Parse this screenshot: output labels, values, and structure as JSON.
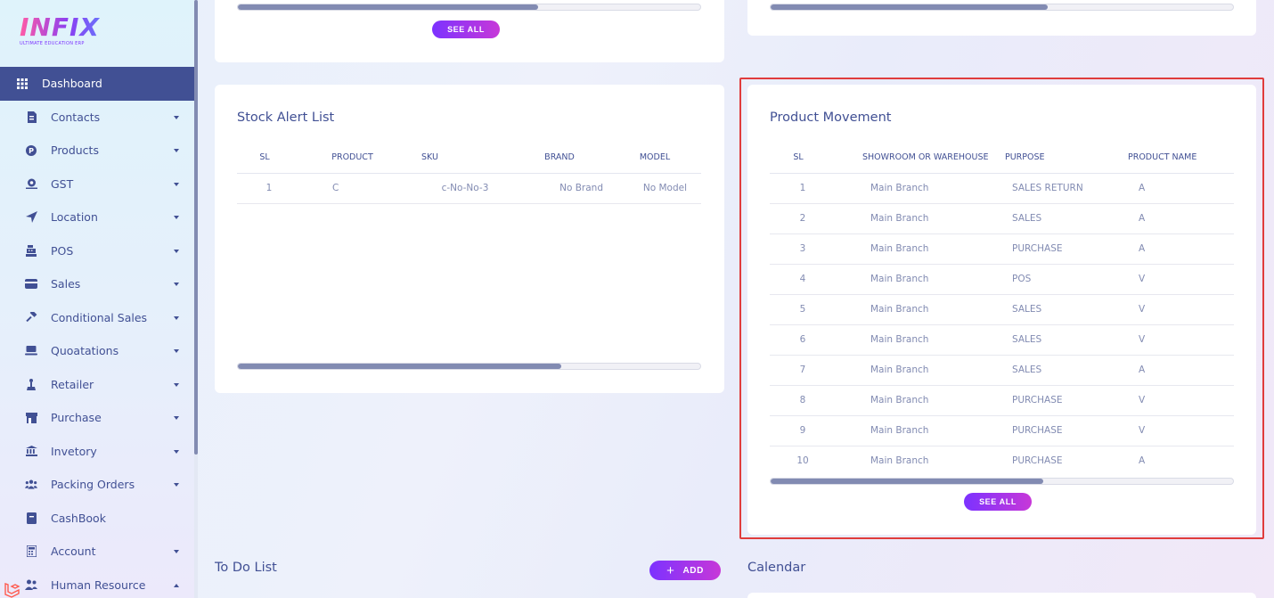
{
  "app": {
    "logo_text": "INFIX",
    "logo_subtitle": "ULTIMATE EDUCATION ERP"
  },
  "sidebar": {
    "items": [
      {
        "label": "Dashboard",
        "icon": "grid-icon",
        "active": true
      },
      {
        "label": "Contacts",
        "icon": "contact-card-icon",
        "caret": "down"
      },
      {
        "label": "Products",
        "icon": "product-circle-icon",
        "caret": "down"
      },
      {
        "label": "GST",
        "icon": "tax-icon",
        "caret": "down"
      },
      {
        "label": "Location",
        "icon": "location-arrow-icon",
        "caret": "down"
      },
      {
        "label": "POS",
        "icon": "cash-register-icon",
        "caret": "down"
      },
      {
        "label": "Sales",
        "icon": "credit-card-icon",
        "caret": "down"
      },
      {
        "label": "Conditional Sales",
        "icon": "gavel-icon",
        "caret": "down"
      },
      {
        "label": "Quoatations",
        "icon": "laptop-icon",
        "caret": "down"
      },
      {
        "label": "Retailer",
        "icon": "person-icon",
        "caret": "down"
      },
      {
        "label": "Purchase",
        "icon": "store-icon",
        "caret": "down"
      },
      {
        "label": "Invetory",
        "icon": "bank-icon",
        "caret": "down"
      },
      {
        "label": "Packing Orders",
        "icon": "users-icon",
        "caret": "down"
      },
      {
        "label": "CashBook",
        "icon": "book-icon",
        "caret": ""
      },
      {
        "label": "Account",
        "icon": "calculator-icon",
        "caret": "down"
      },
      {
        "label": "Human Resource",
        "icon": "people-icon",
        "caret": "up"
      }
    ]
  },
  "top_left_card": {
    "see_all_label": "SEE ALL",
    "scroll_fill_pct": 65
  },
  "top_right_card": {
    "scroll_fill_pct": 60
  },
  "stock_alert": {
    "title": "Stock Alert List",
    "columns": [
      "SL",
      "PRODUCT",
      "SKU",
      "BRAND",
      "MODEL"
    ],
    "rows": [
      [
        "1",
        "C",
        "c-No-No-3",
        "No Brand",
        "No Model"
      ]
    ],
    "scroll_fill_pct": 70
  },
  "product_movement": {
    "title": "Product Movement",
    "columns": [
      "SL",
      "SHOWROOM OR WAREHOUSE",
      "PURPOSE",
      "PRODUCT NAME"
    ],
    "rows": [
      [
        "1",
        "Main Branch",
        "SALES RETURN",
        "A"
      ],
      [
        "2",
        "Main Branch",
        "SALES",
        "A"
      ],
      [
        "3",
        "Main Branch",
        "PURCHASE",
        "A"
      ],
      [
        "4",
        "Main Branch",
        "POS",
        "V"
      ],
      [
        "5",
        "Main Branch",
        "SALES",
        "V"
      ],
      [
        "6",
        "Main Branch",
        "SALES",
        "V"
      ],
      [
        "7",
        "Main Branch",
        "SALES",
        "A"
      ],
      [
        "8",
        "Main Branch",
        "PURCHASE",
        "V"
      ],
      [
        "9",
        "Main Branch",
        "PURCHASE",
        "V"
      ],
      [
        "10",
        "Main Branch",
        "PURCHASE",
        "A"
      ]
    ],
    "see_all_label": "SEE ALL",
    "scroll_fill_pct": 59
  },
  "todo": {
    "title": "To Do List",
    "add_label": "ADD"
  },
  "calendar": {
    "title": "Calendar"
  },
  "colors": {
    "primary": "#415094",
    "muted": "#828bb2",
    "accent_start": "#7c32ff",
    "accent_end": "#c738d8",
    "highlight": "#e03c3c"
  }
}
